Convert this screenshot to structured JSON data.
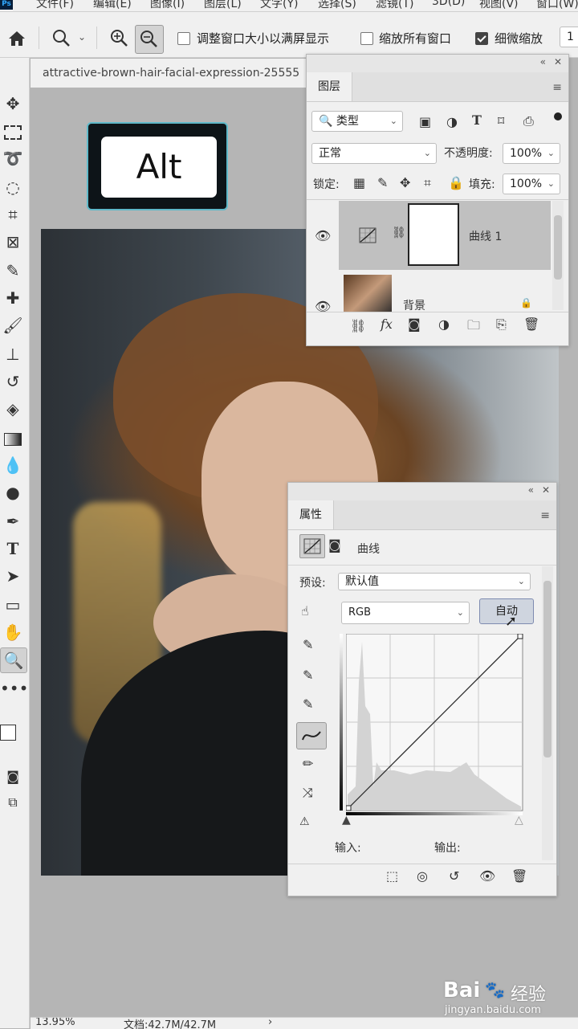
{
  "menubar": {
    "app_icon": "Ps",
    "items": [
      {
        "label": "文件(F)"
      },
      {
        "label": "编辑(E)"
      },
      {
        "label": "图像(I)"
      },
      {
        "label": "图层(L)"
      },
      {
        "label": "文字(Y)"
      },
      {
        "label": "选择(S)"
      },
      {
        "label": "滤镜(T)"
      },
      {
        "label": "3D(D)"
      },
      {
        "label": "视图(V)"
      },
      {
        "label": "窗口(W)"
      }
    ]
  },
  "options": {
    "resize_windows": {
      "label": "调整窗口大小以满屏显示",
      "checked": false
    },
    "zoom_all": {
      "label": "缩放所有窗口",
      "checked": false
    },
    "scrubby_zoom": {
      "label": "细微缩放",
      "checked": true
    },
    "zoom_value": "1"
  },
  "document": {
    "tab_title": "attractive-brown-hair-facial-expression-25555"
  },
  "overlay": {
    "key_label": "Alt"
  },
  "layers_panel": {
    "tab": "图层",
    "filter_kind": "类型",
    "blend_mode": "正常",
    "opacity_label": "不透明度:",
    "opacity_value": "100%",
    "lock_label": "锁定:",
    "fill_label": "填充:",
    "fill_value": "100%",
    "layers": [
      {
        "name": "曲线 1",
        "selected": true
      },
      {
        "name": "背景",
        "selected": false
      }
    ]
  },
  "properties_panel": {
    "tab": "属性",
    "adjustment_name": "曲线",
    "preset_label": "预设:",
    "preset_value": "默认值",
    "channel_value": "RGB",
    "auto_button": "自动",
    "input_label": "输入:",
    "output_label": "输出:"
  },
  "status": {
    "zoom": "13.95%",
    "doc_size": "文档:42.7M/42.7M",
    "arrow": "›"
  },
  "watermark": {
    "brand": "Bai",
    "brand_cn": "经验",
    "url": "jingyan.baidu.com"
  },
  "colors": {
    "accent_cyan": "#5fb9c9",
    "panel_bg": "#f0f0f0",
    "canvas_bg": "#b5b5b5"
  }
}
